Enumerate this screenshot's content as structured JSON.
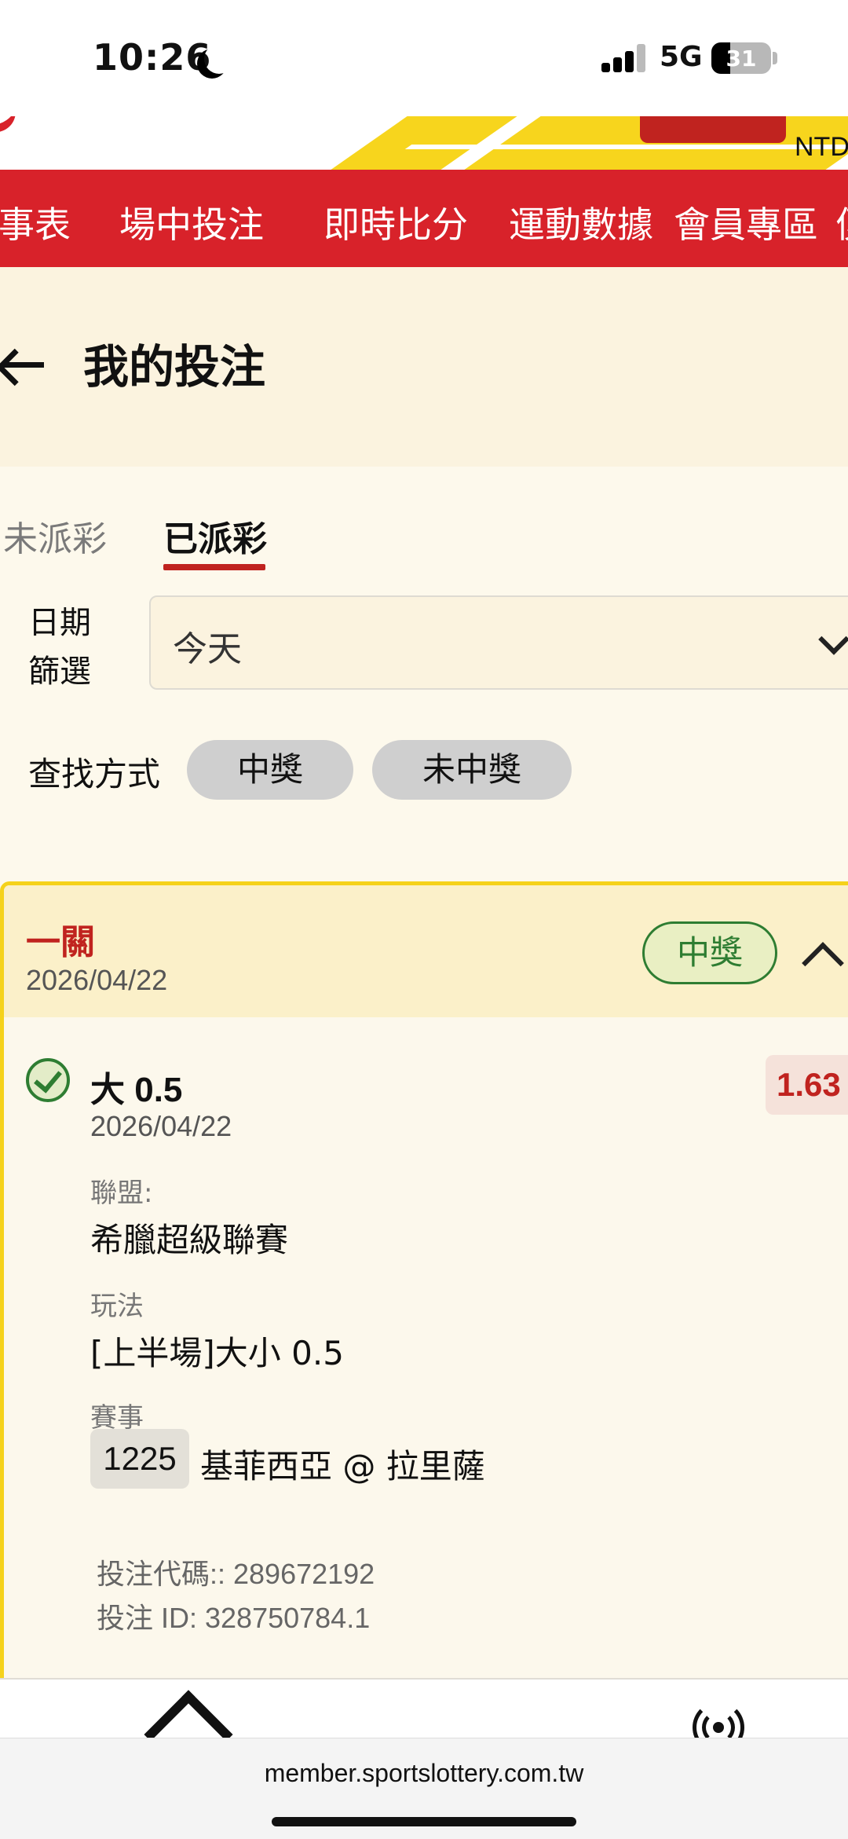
{
  "status_bar": {
    "time": "10:26",
    "network": "5G",
    "battery": "31",
    "battery_level": 0.31
  },
  "header": {
    "currency": "NTD"
  },
  "nav": {
    "items": [
      "事表",
      "場中投注",
      "即時比分",
      "運動數據",
      "會員專區",
      "便"
    ]
  },
  "page": {
    "title": "我的投注"
  },
  "tabs": [
    {
      "label": "未派彩",
      "active": false
    },
    {
      "label": "已派彩",
      "active": true
    }
  ],
  "filters": {
    "date_label_line1": "日期",
    "date_label_line2": "篩選",
    "date_value": "今天",
    "search_label": "查找方式",
    "chips": [
      "中獎",
      "未中獎"
    ]
  },
  "bet": {
    "type": "一關",
    "date": "2026/04/22",
    "status": "中獎",
    "selection": "大 0.5",
    "selection_date": "2026/04/22",
    "odds": "1.63",
    "league_label": "聯盟:",
    "league": "希臘超級聯賽",
    "play_label": "玩法",
    "play": "[上半場]大小 0.5",
    "match_label": "賽事",
    "match_no": "1225",
    "match": "基菲西亞 @ 拉里薩",
    "code_line": "投注代碼:: 289672192",
    "id_line": "投注 ID: 328750784.1"
  },
  "browser": {
    "url": "member.sportslottery.com.tw"
  },
  "colors": {
    "brand_red": "#d8222a",
    "accent_yellow": "#f7d51d",
    "win_green": "#2e7d32",
    "odds_red": "#c0231f"
  }
}
